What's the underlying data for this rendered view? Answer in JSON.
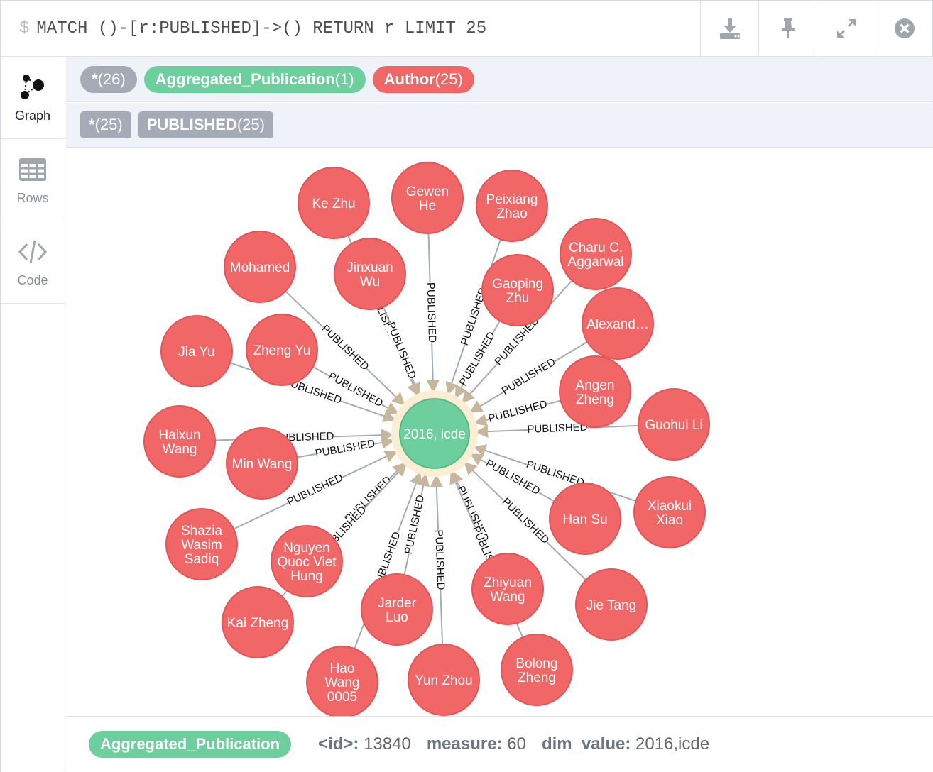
{
  "query": {
    "prompt": "$",
    "text": "MATCH ()-[r:PUBLISHED]->() RETURN r LIMIT 25"
  },
  "toolbar": {
    "download_icon": "download-icon",
    "pin_icon": "pin-icon",
    "expand_icon": "expand-icon",
    "close_icon": "close-icon"
  },
  "sidebar": {
    "items": [
      {
        "label": "Graph",
        "icon": "graph-icon",
        "active": true
      },
      {
        "label": "Rows",
        "icon": "table-icon",
        "active": false
      },
      {
        "label": "Code",
        "icon": "code-icon",
        "active": false
      }
    ]
  },
  "legend": {
    "nodes": [
      {
        "name": "*",
        "count": "(26)",
        "color": "#a5abb6"
      },
      {
        "name": "Aggregated_Publication",
        "count": "(1)",
        "color": "#6dce9e"
      },
      {
        "name": "Author",
        "count": "(25)",
        "color": "#f16667"
      }
    ],
    "relationships": [
      {
        "name": "*",
        "count": "(25)"
      },
      {
        "name": "PUBLISHED",
        "count": "(25)"
      }
    ]
  },
  "graph": {
    "center": {
      "label": "2016, icde",
      "color": "#6dce9e"
    },
    "edge_label": "PUBLISHED",
    "author_color": "#f16667",
    "authors": [
      [
        "Ke Zhu"
      ],
      [
        "Gewen",
        "He"
      ],
      [
        "Peixiang",
        "Zhao"
      ],
      [
        "Charu C.",
        "Aggarwal"
      ],
      [
        "Mohamed"
      ],
      [
        "Jinxuan",
        "Wu"
      ],
      [
        "Gaoping",
        "Zhu"
      ],
      [
        "Alexand…"
      ],
      [
        "Jia Yu"
      ],
      [
        "Zheng Yu"
      ],
      [
        "Angen",
        "Zheng"
      ],
      [
        "Guohui Li"
      ],
      [
        "Haixun",
        "Wang"
      ],
      [
        "Min Wang"
      ],
      [
        "Han Su"
      ],
      [
        "Xiaokui",
        "Xiao"
      ],
      [
        "Shazia",
        "Wasim",
        "Sadiq"
      ],
      [
        "Nguyen",
        "Quoc Viet",
        "Hung"
      ],
      [
        "Jie Tang"
      ],
      [
        "Kai Zheng"
      ],
      [
        "Jarder",
        "Luo"
      ],
      [
        "Zhiyuan",
        "Wang"
      ],
      [
        "Hao",
        "Wang",
        "0005"
      ],
      [
        "Yun Zhou"
      ],
      [
        "Bolong",
        "Zheng"
      ]
    ]
  },
  "footer": {
    "label": "Aggregated_Publication",
    "props": [
      {
        "key": "<id>:",
        "value": "13840"
      },
      {
        "key": "measure:",
        "value": "60"
      },
      {
        "key": "dim_value:",
        "value": "2016,icde"
      }
    ]
  }
}
